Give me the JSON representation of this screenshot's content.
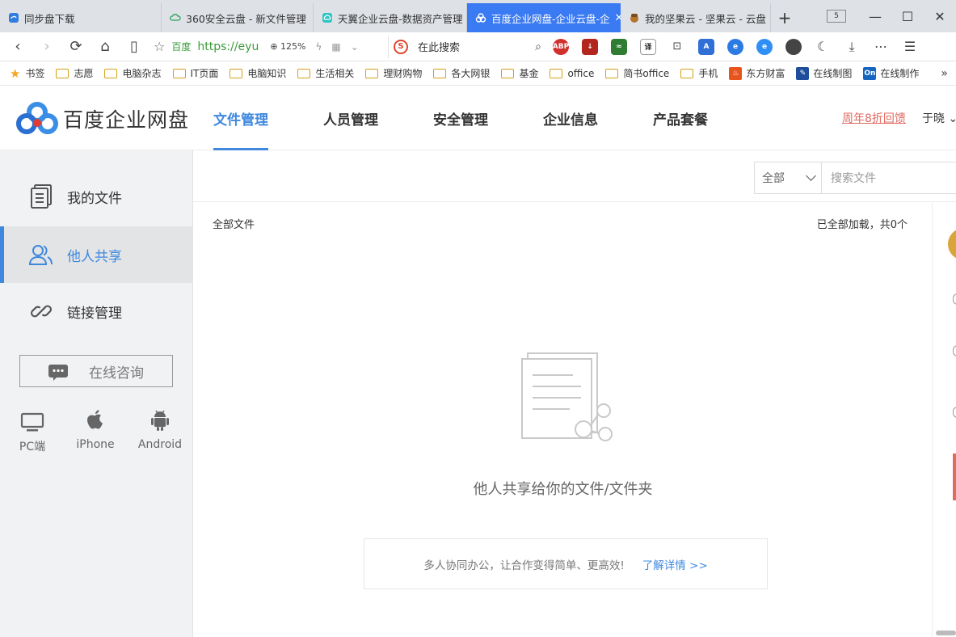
{
  "browser": {
    "tabs": [
      {
        "title": "同步盘下载",
        "active": false
      },
      {
        "title": "360安全云盘 - 新文件管理",
        "active": false
      },
      {
        "title": "天翼企业云盘-数据资产管理",
        "active": false
      },
      {
        "title": "百度企业网盘-企业云盘-企",
        "active": true
      },
      {
        "title": "我的坚果云 - 坚果云 - 云盘",
        "active": false
      }
    ],
    "new_tab": "+",
    "tab_counter": "5",
    "window_controls": {
      "minimize": "—",
      "maximize": "☐",
      "close": "✕"
    },
    "address": {
      "site_label": "百度",
      "url": "https://eyu",
      "zoom": "125%",
      "search_placeholder": "在此搜索"
    },
    "extensions": [
      "ABP",
      "译"
    ],
    "bookmarks": [
      {
        "label": "书签",
        "type": "star"
      },
      {
        "label": "志愿",
        "type": "folder"
      },
      {
        "label": "电脑杂志",
        "type": "folder"
      },
      {
        "label": "IT页面",
        "type": "folder"
      },
      {
        "label": "电脑知识",
        "type": "folder"
      },
      {
        "label": "生活相关",
        "type": "folder"
      },
      {
        "label": "理财购物",
        "type": "folder"
      },
      {
        "label": "各大网银",
        "type": "folder"
      },
      {
        "label": "基金",
        "type": "folder"
      },
      {
        "label": "office",
        "type": "folder"
      },
      {
        "label": "简书office",
        "type": "folder"
      },
      {
        "label": "手机",
        "type": "folder"
      },
      {
        "label": "东方财富",
        "type": "site"
      },
      {
        "label": "在线制图",
        "type": "site"
      },
      {
        "label": "在线制作",
        "type": "site"
      }
    ],
    "bookmarks_more": "»"
  },
  "app": {
    "brand": "百度企业网盘",
    "nav": [
      {
        "label": "文件管理",
        "active": true
      },
      {
        "label": "人员管理",
        "active": false
      },
      {
        "label": "安全管理",
        "active": false
      },
      {
        "label": "企业信息",
        "active": false
      },
      {
        "label": "产品套餐",
        "active": false
      }
    ],
    "promo": "周年8折回馈",
    "user": "于晓"
  },
  "sidebar": {
    "items": [
      {
        "label": "我的文件",
        "icon": "document-icon",
        "active": false
      },
      {
        "label": "他人共享",
        "icon": "users-icon",
        "active": true
      },
      {
        "label": "链接管理",
        "icon": "link-icon",
        "active": false
      }
    ],
    "consult_label": "在线咨询",
    "platforms": [
      {
        "label": "PC端",
        "icon": "monitor-icon"
      },
      {
        "label": "iPhone",
        "icon": "apple-icon"
      },
      {
        "label": "Android",
        "icon": "android-icon"
      }
    ]
  },
  "main": {
    "filter_value": "全部",
    "search_placeholder": "搜索文件",
    "breadcrumb": "全部文件",
    "count_text": "已全部加载，共0个",
    "empty_text": "他人共享给你的文件/文件夹",
    "tip_text": "多人协同办公，让合作变得简单、更高效!",
    "tip_link": "了解详情 >>"
  },
  "colors": {
    "accent": "#3f88de",
    "tab_active": "#3a7af2",
    "promo": "#e06b61"
  }
}
